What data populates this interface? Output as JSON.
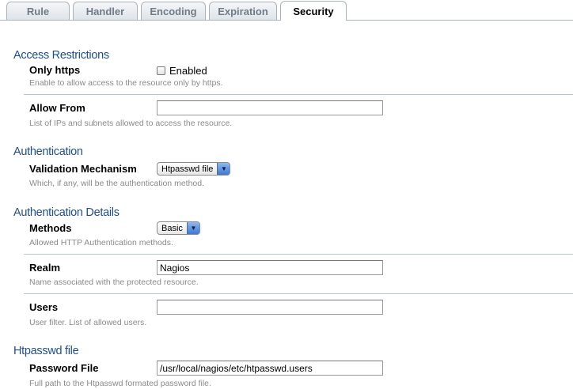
{
  "tabs": [
    {
      "label": "Rule"
    },
    {
      "label": "Handler"
    },
    {
      "label": "Encoding"
    },
    {
      "label": "Expiration"
    },
    {
      "label": "Security"
    }
  ],
  "active_tab": "Security",
  "sections": {
    "access_restrictions": {
      "title": "Access Restrictions",
      "only_https": {
        "label": "Only https",
        "checkbox_label": "Enabled",
        "checked": false,
        "help": "Enable to allow access to the resource only by https."
      },
      "allow_from": {
        "label": "Allow From",
        "value": "",
        "help": "List of IPs and subnets allowed to access the resource."
      }
    },
    "authentication": {
      "title": "Authentication",
      "validation_mechanism": {
        "label": "Validation Mechanism",
        "selected": "Htpasswd file",
        "help": "Which, if any, will be the authentication method."
      }
    },
    "authentication_details": {
      "title": "Authentication Details",
      "methods": {
        "label": "Methods",
        "selected": "Basic",
        "help": "Allowed HTTP Authentication methods."
      },
      "realm": {
        "label": "Realm",
        "value": "Nagios",
        "help": "Name associated with the protected resource."
      },
      "users": {
        "label": "Users",
        "value": "",
        "help": "User filter. List of allowed users."
      }
    },
    "htpasswd_file": {
      "title": "Htpasswd file",
      "password_file": {
        "label": "Password File",
        "value": "/usr/local/nagios/etc/htpasswd.users",
        "help": "Full path to the Htpasswd formated password file."
      }
    }
  },
  "colors": {
    "section_title": "#1f4e8a",
    "help_text": "#8a8a8a",
    "separator": "#b8c4cf",
    "select_arrow": "#3c78d3"
  },
  "icons": {
    "select_arrow": "triangle-down-icon"
  }
}
